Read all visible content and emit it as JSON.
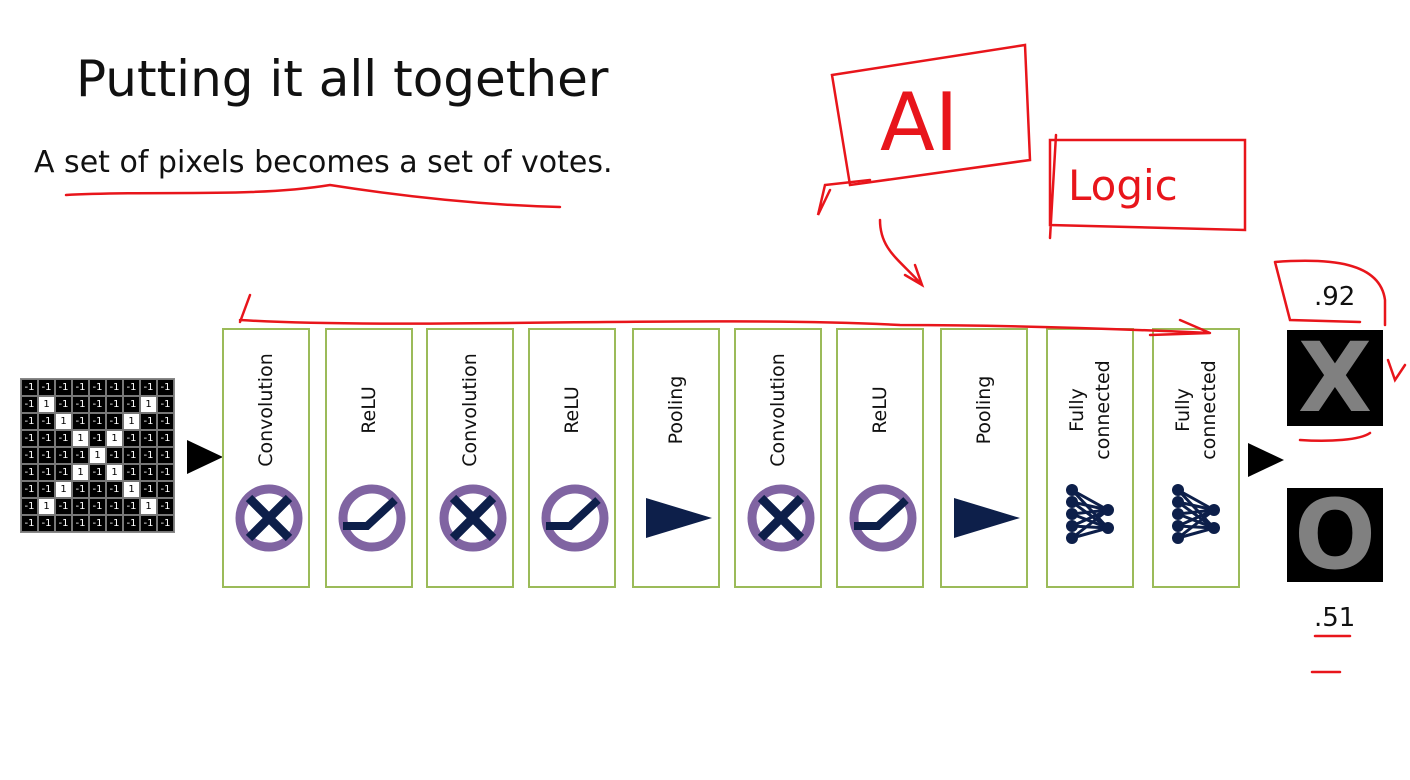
{
  "title": "Putting it all together",
  "subtitle": "A set of pixels becomes a set of votes.",
  "input_grid": [
    [
      -1,
      -1,
      -1,
      -1,
      -1,
      -1,
      -1,
      -1,
      -1
    ],
    [
      -1,
      1,
      -1,
      -1,
      -1,
      -1,
      -1,
      1,
      -1
    ],
    [
      -1,
      -1,
      1,
      -1,
      -1,
      -1,
      1,
      -1,
      -1
    ],
    [
      -1,
      -1,
      -1,
      1,
      -1,
      1,
      -1,
      -1,
      -1
    ],
    [
      -1,
      -1,
      -1,
      -1,
      1,
      -1,
      -1,
      -1,
      -1
    ],
    [
      -1,
      -1,
      -1,
      1,
      -1,
      1,
      -1,
      -1,
      -1
    ],
    [
      -1,
      -1,
      1,
      -1,
      -1,
      -1,
      1,
      -1,
      -1
    ],
    [
      -1,
      1,
      -1,
      -1,
      -1,
      -1,
      -1,
      1,
      -1
    ],
    [
      -1,
      -1,
      -1,
      -1,
      -1,
      -1,
      -1,
      -1,
      -1
    ]
  ],
  "layers": [
    {
      "label": "Convolution",
      "icon": "convolution"
    },
    {
      "label": "ReLU",
      "icon": "relu"
    },
    {
      "label": "Convolution",
      "icon": "convolution"
    },
    {
      "label": "ReLU",
      "icon": "relu"
    },
    {
      "label": "Pooling",
      "icon": "pooling"
    },
    {
      "label": "Convolution",
      "icon": "convolution"
    },
    {
      "label": "ReLU",
      "icon": "relu"
    },
    {
      "label": "Pooling",
      "icon": "pooling"
    },
    {
      "label": "Fully connected",
      "icon": "fully-connected"
    },
    {
      "label": "Fully connected",
      "icon": "fully-connected"
    }
  ],
  "outputs": [
    {
      "label": "X",
      "score": ".92"
    },
    {
      "label": "O",
      "score": ".51"
    }
  ],
  "annotations": {
    "ai": "AI",
    "logic": "Logic"
  },
  "colors": {
    "ink": "#e8151b",
    "box_border": "#9bbb59",
    "icon_navy": "#0d1f4a",
    "icon_purple": "#8064a2"
  }
}
